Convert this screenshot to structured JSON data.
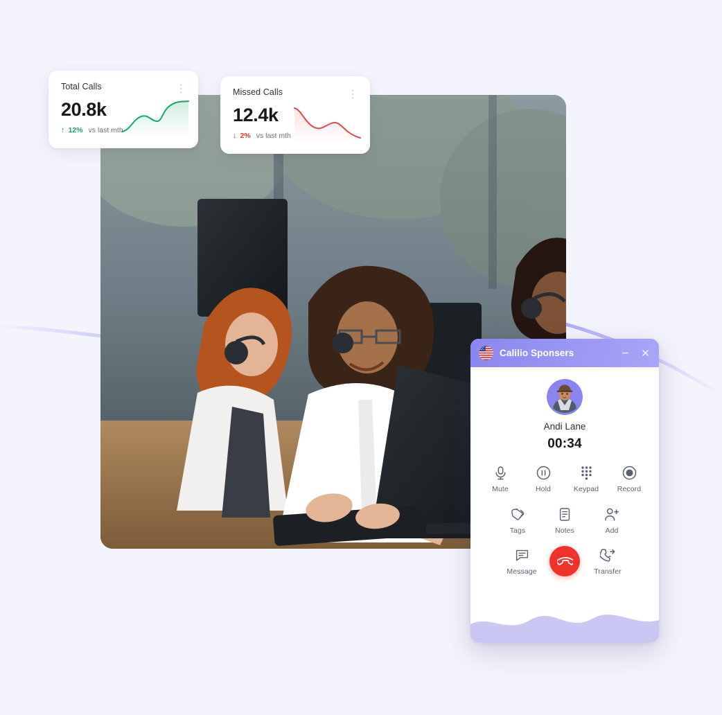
{
  "page": {
    "background_color": "#f4f4fd",
    "accent_purple": "#9b97f4"
  },
  "stat_cards": [
    {
      "id": "total-calls",
      "title": "Total Calls",
      "value": "20.8k",
      "delta_direction": "up",
      "delta_arrow": "↑",
      "delta_pct": "12%",
      "delta_note": "vs last mth",
      "accent_color": "#17a868",
      "menu_icon": "kebab-menu-icon",
      "sparkline": {
        "type": "line",
        "color": "#17a868",
        "fill": "#e4f5ed",
        "values": [
          8,
          14,
          30,
          34,
          27,
          21,
          22,
          38,
          56,
          60
        ]
      }
    },
    {
      "id": "missed-calls",
      "title": "Missed Calls",
      "value": "12.4k",
      "delta_direction": "down",
      "delta_arrow": "↓",
      "delta_pct": "2%",
      "delta_note": "vs last mth",
      "accent_color": "#e0342c",
      "menu_icon": "kebab-menu-icon",
      "sparkline": {
        "type": "line",
        "color": "#d94b52",
        "fill": "#fbeaea",
        "values": [
          56,
          50,
          34,
          20,
          18,
          26,
          31,
          28,
          16,
          8
        ]
      }
    }
  ],
  "hero_photo": {
    "alt": "call center agents wearing headsets at desktop computers",
    "icon": "photo-placeholder"
  },
  "call_dialog": {
    "header": {
      "flag_icon": "us-flag-icon",
      "title": "Calilio Sponsers",
      "minimize_label": "–",
      "close_label": "×"
    },
    "caller": {
      "avatar_icon": "user-avatar",
      "name": "Andi Lane",
      "timer": "00:34"
    },
    "controls_row_1": [
      {
        "id": "mute",
        "label": "Mute",
        "icon": "microphone-icon"
      },
      {
        "id": "hold",
        "label": "Hold",
        "icon": "pause-circle-icon"
      },
      {
        "id": "keypad",
        "label": "Keypad",
        "icon": "keypad-grid-icon"
      },
      {
        "id": "record",
        "label": "Record",
        "icon": "record-circle-icon"
      }
    ],
    "controls_row_2": [
      {
        "id": "tags",
        "label": "Tags",
        "icon": "tags-icon"
      },
      {
        "id": "notes",
        "label": "Notes",
        "icon": "notes-icon"
      },
      {
        "id": "add",
        "label": "Add",
        "icon": "user-plus-icon"
      }
    ],
    "controls_row_3": [
      {
        "id": "message",
        "label": "Message",
        "icon": "message-bubble-icon"
      },
      {
        "id": "transfer",
        "label": "Transfer",
        "icon": "call-transfer-icon"
      }
    ],
    "end_call": {
      "icon": "phone-hangup-icon",
      "color": "#f0322a"
    }
  }
}
